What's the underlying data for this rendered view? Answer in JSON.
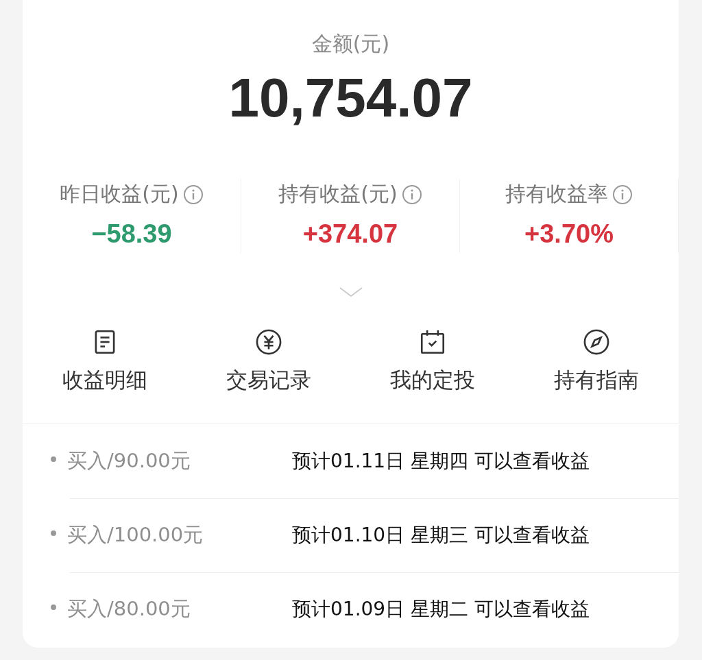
{
  "amount": {
    "label": "金额(元)",
    "value": "10,754.07"
  },
  "stats": [
    {
      "label": "昨日收益(元)",
      "value": "−58.39",
      "color": "#2e9b6e"
    },
    {
      "label": "持有收益(元)",
      "value": "+374.07",
      "color": "#d6343f"
    },
    {
      "label": "持有收益率",
      "value": "+3.70%",
      "color": "#d6343f"
    }
  ],
  "actions": [
    {
      "label": "收益明细",
      "kind": "document"
    },
    {
      "label": "交易记录",
      "kind": "yuan"
    },
    {
      "label": "我的定投",
      "kind": "calendar"
    },
    {
      "label": "持有指南",
      "kind": "compass"
    }
  ],
  "orders": [
    {
      "label": "买入/90.00元",
      "message": "预计01.11日 星期四 可以查看收益"
    },
    {
      "label": "买入/100.00元",
      "message": "预计01.10日 星期三 可以查看收益"
    },
    {
      "label": "买入/80.00元",
      "message": "预计01.09日 星期二 可以查看收益"
    }
  ]
}
